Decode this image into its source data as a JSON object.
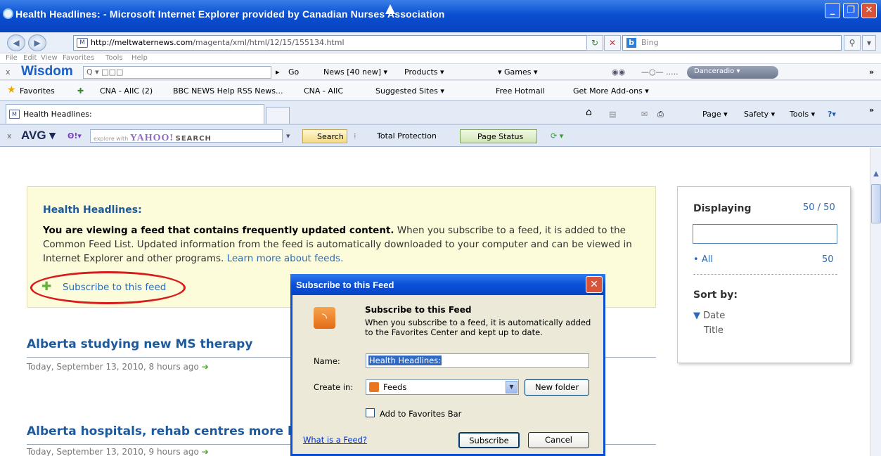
{
  "window": {
    "title": "Health Headlines: - Microsoft Internet Explorer provided by Canadian Nurses Association",
    "min_label": "_",
    "max_label": "❐",
    "close_label": "✕"
  },
  "address": {
    "back_icon": "◀",
    "forward_icon": "▶",
    "url_host": "http://meltwaternews.com",
    "url_path": "/magenta/xml/html/12/15/155134.html",
    "search_placeholder": "Bing",
    "bing_letter": "b"
  },
  "menu": {
    "items": [
      "File",
      "Edit",
      "View",
      "Favorites",
      "Tools",
      "Help"
    ]
  },
  "wisdom_bar": {
    "close": "x",
    "brand": "Wisdom",
    "search_text": "Q ▾ □□□",
    "go": "Go",
    "news": "News [40 new] ▾",
    "products": "Products ▾",
    "games": "▾ Games ▾",
    "player_track": "—○— .....",
    "radio": "Danceradio ▾",
    "more": "»"
  },
  "favorites_bar": {
    "favorites": "Favorites",
    "items": [
      "CNA - AIIC (2)",
      "BBC NEWS Help RSS News...",
      "CNA - AIIC",
      "Suggested Sites ▾",
      "Free Hotmail",
      "Get More Add-ons ▾"
    ]
  },
  "tabs": {
    "active": "Health Headlines:",
    "commands": [
      "Page ▾",
      "Safety ▾",
      "Tools ▾"
    ],
    "more": "»"
  },
  "avg_bar": {
    "close": "x",
    "brand": "AVG ▾",
    "explore": "explore with",
    "yahoo": "YAHOO!",
    "search_word": "SEARCH",
    "search_button": "Search",
    "total_protection": "Total Protection",
    "page_status": "Page Status"
  },
  "feed_info": {
    "title": "Health Headlines:",
    "bold_intro": "You are viewing a feed that contains frequently updated content.",
    "body": " When you subscribe to a feed, it is added to the Common Feed List. Updated information from the feed is automatically downloaded to your computer and can be viewed in Internet Explorer and other programs.",
    "learn_more": "Learn more about feeds.",
    "subscribe_link": "Subscribe to this feed"
  },
  "articles": [
    {
      "title": "Alberta studying new MS therapy",
      "date": "Today, September 13, 2010, 8 hours ago"
    },
    {
      "title": "Alberta hospitals, rehab centres more lik",
      "date": "Today, September 13, 2010, 9 hours ago"
    }
  ],
  "right_panel": {
    "displaying": "Displaying",
    "count": "50 / 50",
    "all_label": "All",
    "all_count": "50",
    "sort_by": "Sort by:",
    "sort_date": "Date",
    "sort_title": "Title"
  },
  "dialog": {
    "title": "Subscribe to this Feed",
    "heading": "Subscribe to this Feed",
    "description": "When you subscribe to a feed, it is automatically added to the Favorites Center and kept up to date.",
    "name_label": "Name:",
    "name_value": "Health Headlines:",
    "create_label": "Create in:",
    "create_value": "Feeds",
    "new_folder": "New folder",
    "add_fav_bar": "Add to Favorites Bar",
    "what_is": "What is a Feed?",
    "subscribe": "Subscribe",
    "cancel": "Cancel",
    "close_label": "✕"
  },
  "colors": {
    "title_blue": "#0a4fd2",
    "link_blue": "#2a6cb8",
    "heading_blue": "#1e5a9b",
    "infobox_bg": "#fcfbda",
    "highlight_red": "#d81c1c"
  }
}
